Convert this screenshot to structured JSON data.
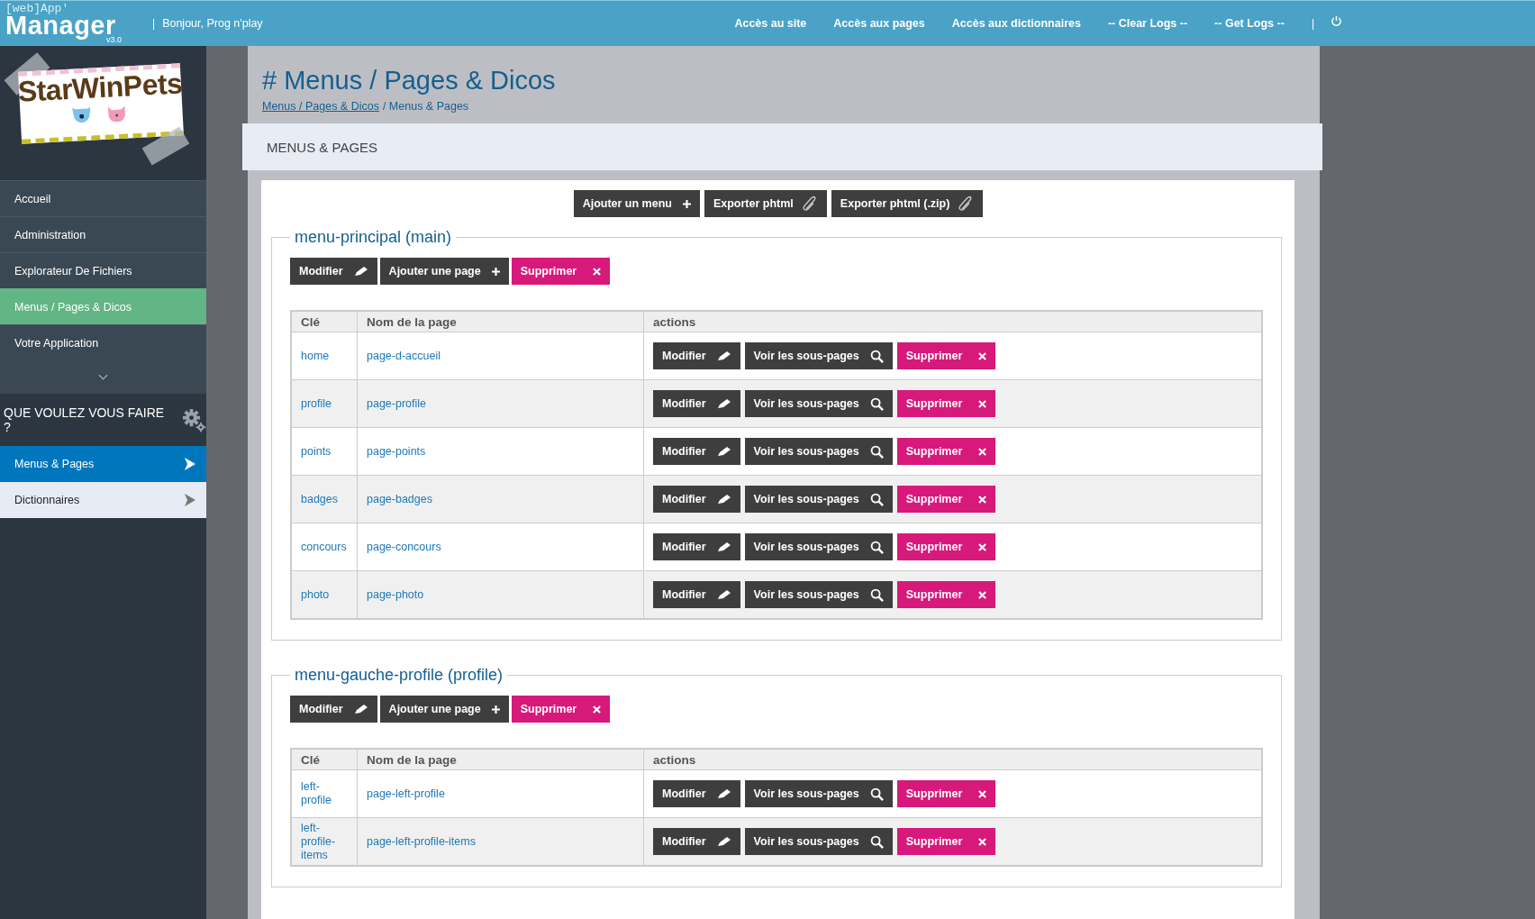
{
  "header": {
    "logo_top": "[web]App'",
    "logo_main": "Manager",
    "logo_version": "v3.0",
    "greeting_separator": "|",
    "greeting": "Bonjour, Prog n'play",
    "nav": [
      "Accès au site",
      "Accès aux pages",
      "Accès aux dictionnaires",
      "-- Clear Logs --",
      "-- Get Logs --"
    ],
    "power_separator": "|"
  },
  "sidebar": {
    "logo_text": "StarWinPets",
    "items": [
      {
        "label": "Accueil",
        "selected": false
      },
      {
        "label": "Administration",
        "selected": false
      },
      {
        "label": "Explorateur De Fichiers",
        "selected": false
      },
      {
        "label": "Menus / Pages & Dicos",
        "selected": true
      },
      {
        "label": "Votre Application",
        "selected": false
      }
    ],
    "section_title": "QUE VOULEZ VOUS FAIRE ?",
    "actions": [
      {
        "label": "Menus & Pages",
        "selected": true
      },
      {
        "label": "Dictionnaires",
        "selected": false
      }
    ]
  },
  "page": {
    "title": "# Menus / Pages & Dicos",
    "breadcrumb": {
      "link": "Menus / Pages & Dicos",
      "current": "/ Menus & Pages"
    },
    "band_title": "MENUS & PAGES",
    "toolbar": [
      {
        "label": "Ajouter un menu",
        "kind": "add"
      },
      {
        "label": "Exporter phtml",
        "kind": "export"
      },
      {
        "label": "Exporter phtml (.zip)",
        "kind": "export"
      }
    ],
    "menus": [
      {
        "title": "menu-principal (main)",
        "buttons": [
          {
            "label": "Modifier",
            "kind": "edit"
          },
          {
            "label": "Ajouter une page",
            "kind": "add"
          },
          {
            "label": "Supprimer",
            "kind": "delete"
          }
        ],
        "columns": [
          "Clé",
          "Nom de la page",
          "actions"
        ],
        "rows": [
          {
            "key": "home",
            "page": "page-d-accueil",
            "actions": [
              {
                "label": "Modifier",
                "kind": "edit"
              },
              {
                "label": "Voir les sous-pages",
                "kind": "subpages"
              },
              {
                "label": "Supprimer",
                "kind": "delete"
              }
            ]
          },
          {
            "key": "profile",
            "page": "page-profile",
            "actions": [
              {
                "label": "Modifier",
                "kind": "edit"
              },
              {
                "label": "Voir les sous-pages",
                "kind": "subpages"
              },
              {
                "label": "Supprimer",
                "kind": "delete"
              }
            ]
          },
          {
            "key": "points",
            "page": "page-points",
            "actions": [
              {
                "label": "Modifier",
                "kind": "edit"
              },
              {
                "label": "Voir les sous-pages",
                "kind": "subpages"
              },
              {
                "label": "Supprimer",
                "kind": "delete"
              }
            ]
          },
          {
            "key": "badges",
            "page": "page-badges",
            "actions": [
              {
                "label": "Modifier",
                "kind": "edit"
              },
              {
                "label": "Voir les sous-pages",
                "kind": "subpages"
              },
              {
                "label": "Supprimer",
                "kind": "delete"
              }
            ]
          },
          {
            "key": "concours",
            "page": "page-concours",
            "actions": [
              {
                "label": "Modifier",
                "kind": "edit"
              },
              {
                "label": "Voir les sous-pages",
                "kind": "subpages"
              },
              {
                "label": "Supprimer",
                "kind": "delete"
              }
            ]
          },
          {
            "key": "photo",
            "page": "page-photo",
            "actions": [
              {
                "label": "Modifier",
                "kind": "edit"
              },
              {
                "label": "Voir les sous-pages",
                "kind": "subpages"
              },
              {
                "label": "Supprimer",
                "kind": "delete"
              }
            ]
          }
        ]
      },
      {
        "title": "menu-gauche-profile (profile)",
        "buttons": [
          {
            "label": "Modifier",
            "kind": "edit"
          },
          {
            "label": "Ajouter une page",
            "kind": "add"
          },
          {
            "label": "Supprimer",
            "kind": "delete"
          }
        ],
        "columns": [
          "Clé",
          "Nom de la page",
          "actions"
        ],
        "rows": [
          {
            "key": "left-profile",
            "page": "page-left-profile",
            "actions": [
              {
                "label": "Modifier",
                "kind": "edit"
              },
              {
                "label": "Voir les sous-pages",
                "kind": "subpages"
              },
              {
                "label": "Supprimer",
                "kind": "delete"
              }
            ]
          },
          {
            "key": "left-profile-items",
            "page": "page-left-profile-items",
            "actions": [
              {
                "label": "Modifier",
                "kind": "edit"
              },
              {
                "label": "Voir les sous-pages",
                "kind": "subpages"
              },
              {
                "label": "Supprimer",
                "kind": "delete"
              }
            ]
          }
        ]
      }
    ]
  }
}
